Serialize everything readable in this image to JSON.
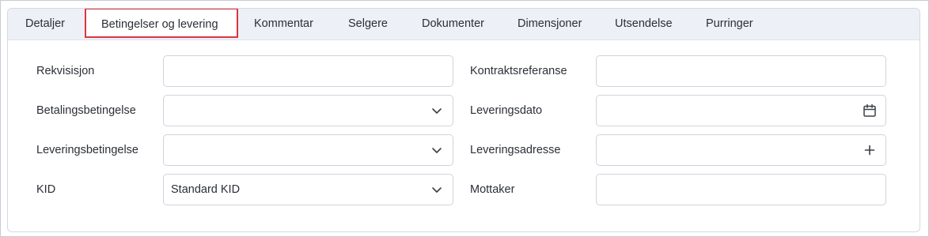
{
  "tabs": [
    {
      "label": "Detaljer",
      "active": false
    },
    {
      "label": "Betingelser og levering",
      "active": true
    },
    {
      "label": "Kommentar",
      "active": false
    },
    {
      "label": "Selgere",
      "active": false
    },
    {
      "label": "Dokumenter",
      "active": false
    },
    {
      "label": "Dimensjoner",
      "active": false
    },
    {
      "label": "Utsendelse",
      "active": false
    },
    {
      "label": "Purringer",
      "active": false
    }
  ],
  "form": {
    "rekvisisjon": {
      "label": "Rekvisisjon",
      "value": ""
    },
    "betalingsbetingelse": {
      "label": "Betalingsbetingelse",
      "value": "",
      "icon": "chevron-down-icon"
    },
    "leveringsbetingelse": {
      "label": "Leveringsbetingelse",
      "value": "",
      "icon": "chevron-down-icon"
    },
    "kid": {
      "label": "KID",
      "value": "Standard KID",
      "icon": "chevron-down-icon"
    },
    "kontraktsreferanse": {
      "label": "Kontraktsreferanse",
      "value": ""
    },
    "leveringsdato": {
      "label": "Leveringsdato",
      "value": "",
      "icon": "calendar-icon"
    },
    "leveringsadresse": {
      "label": "Leveringsadresse",
      "value": "",
      "icon": "plus-icon"
    },
    "mottaker": {
      "label": "Mottaker",
      "value": ""
    }
  },
  "colors": {
    "active_tab_border": "#d9363e",
    "tabbar_background": "#edf0f6",
    "field_border": "#cfd4db"
  }
}
